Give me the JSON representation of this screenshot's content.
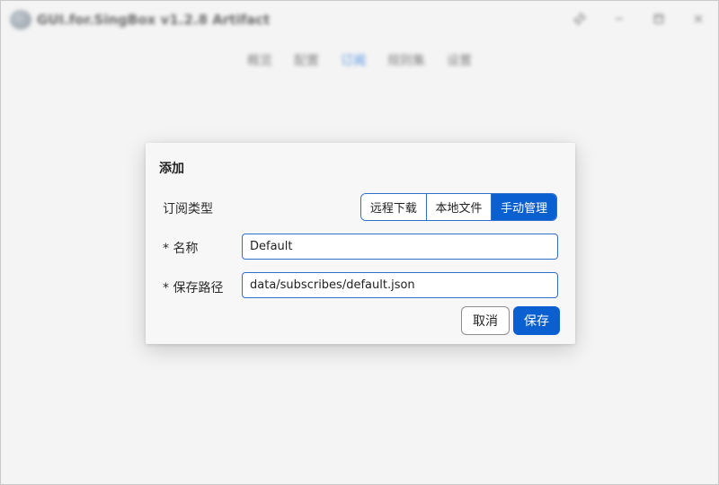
{
  "window": {
    "title": "GUI.for.SingBox v1.2.8 Artifact",
    "controls": {
      "pin_icon": "pin-icon",
      "minimize_icon": "minimize-icon",
      "maximize_icon": "maximize-icon",
      "close_icon": "close-icon"
    }
  },
  "nav": {
    "items": [
      {
        "label": "概览",
        "active": false
      },
      {
        "label": "配置",
        "active": false
      },
      {
        "label": "订阅",
        "active": true
      },
      {
        "label": "规则集",
        "active": false
      },
      {
        "label": "设置",
        "active": false
      }
    ]
  },
  "modal": {
    "title": "添加",
    "subscription_type": {
      "label": "订阅类型",
      "options": [
        "远程下载",
        "本地文件",
        "手动管理"
      ],
      "selected": "手动管理"
    },
    "name": {
      "label": "* 名称",
      "value": "Default"
    },
    "path": {
      "label": "* 保存路径",
      "value": "data/subscribes/default.json"
    },
    "buttons": {
      "cancel": "取消",
      "save": "保存"
    }
  },
  "colors": {
    "accent": "#0a5fd1",
    "border_accent": "#2f6fc8",
    "nav_active": "#3d86e0"
  }
}
